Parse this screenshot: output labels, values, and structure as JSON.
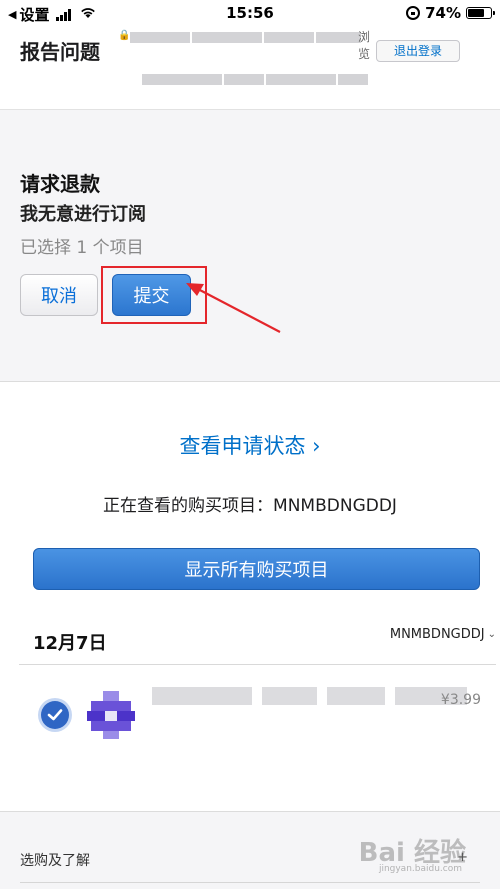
{
  "status_bar": {
    "back_label": "设置",
    "time": "15:56",
    "battery": "74%",
    "battery_level": 0.74
  },
  "header": {
    "page_title": "报告问题",
    "signout_label": "退出登录",
    "url_tail": "浏览"
  },
  "refund": {
    "title": "请求退款",
    "reason": "我无意进行订阅",
    "selected_count": "已选择 1 个项目",
    "cancel_label": "取消",
    "submit_label": "提交"
  },
  "main": {
    "status_link": "查看申请状态 ›",
    "viewing_line": "正在查看的购买项目：MNMBDNGDDJ",
    "show_all_label": "显示所有购买项目"
  },
  "purchase": {
    "date": "12月7日",
    "order_id": "MNMBDNGDDJ",
    "items": [
      {
        "price": "¥3.99",
        "selected": true
      }
    ]
  },
  "footer": {
    "label": "选购及了解",
    "plus": "+",
    "watermark": "Bai 经验",
    "watermark_sub": "jingyan.baidu.com"
  },
  "colors": {
    "accent": "#0070c9",
    "button_blue": "#2b73cc",
    "highlight_red": "#e4262b",
    "panel_gray": "#f5f5f7"
  },
  "icons": {
    "back": "back-triangle-icon",
    "wifi": "wifi-icon",
    "orientation_lock": "orientation-lock-icon",
    "check": "checkmark-icon",
    "chevron": "chevron-down-icon"
  }
}
